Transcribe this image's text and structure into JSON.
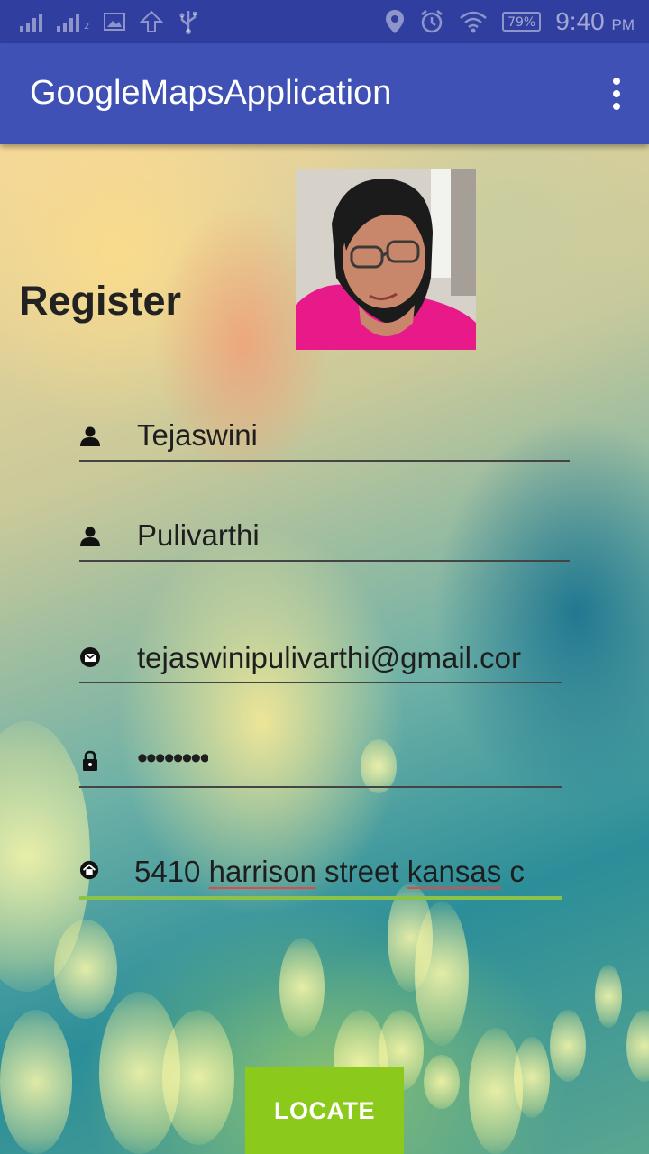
{
  "status_bar": {
    "battery": "79%",
    "time": "9:40",
    "ampm": "PM",
    "sim_slot": "2"
  },
  "app_bar": {
    "title": "GoogleMapsApplication",
    "overflow_icon": "more-vert-icon"
  },
  "form": {
    "heading": "Register",
    "first_name": {
      "icon": "person-icon",
      "value": "Tejaswini"
    },
    "last_name": {
      "icon": "person-icon",
      "value": "Pulivarthi"
    },
    "email": {
      "icon": "email-icon",
      "value": "tejaswinipulivarthi@gmail.cor"
    },
    "password": {
      "icon": "lock-icon",
      "value": "••••••••"
    },
    "address": {
      "icon": "home-icon",
      "value_part1": "5410 ",
      "value_part2": "harrison",
      "value_part3": " street ",
      "value_part4": "kansas",
      "value_part5": " c"
    }
  },
  "locate_button": {
    "label": "LOCATE"
  },
  "colors": {
    "status_bar": "#303f9f",
    "app_bar": "#3f51b5",
    "accent": "#8bc34a",
    "button": "#8bc91a"
  }
}
